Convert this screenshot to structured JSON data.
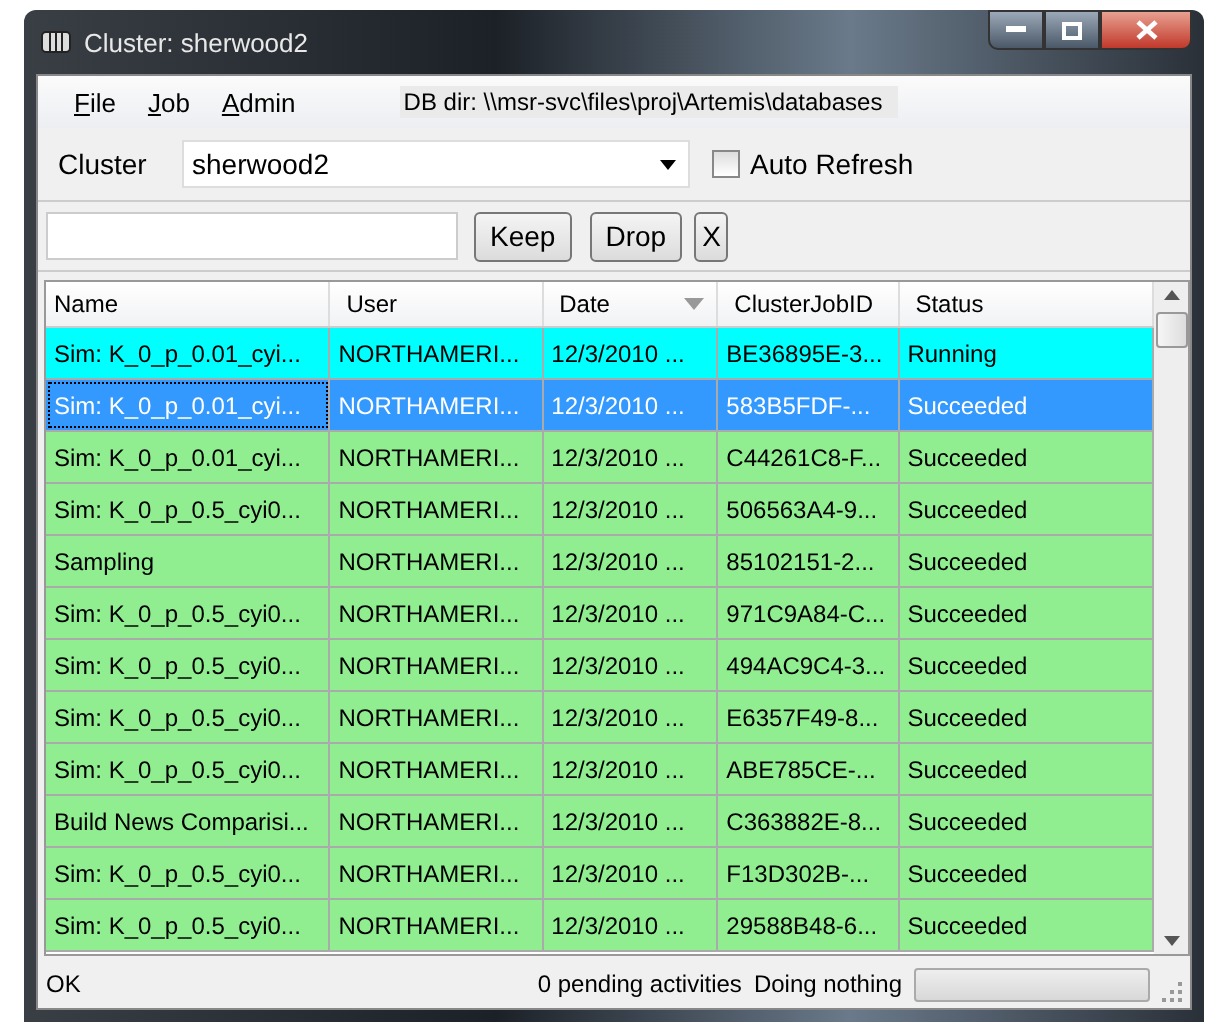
{
  "window": {
    "title": "Cluster: sherwood2"
  },
  "menu": [
    {
      "label": "File"
    },
    {
      "label": "Job"
    },
    {
      "label": "Admin"
    }
  ],
  "db_dir": "DB dir: \\\\msr-svc\\files\\proj\\Artemis\\databases",
  "cluster": {
    "label": "Cluster",
    "value": "sherwood2"
  },
  "auto_refresh": {
    "label": "Auto Refresh",
    "checked": false
  },
  "filter": {
    "buttons": [
      "Keep",
      "Drop",
      "X"
    ]
  },
  "table": {
    "columns": [
      {
        "label": "Name",
        "sorted": false
      },
      {
        "label": "User",
        "sorted": false
      },
      {
        "label": "Date",
        "sorted": true
      },
      {
        "label": "ClusterJobID",
        "sorted": false
      },
      {
        "label": "Status",
        "sorted": false
      }
    ],
    "rows": [
      {
        "cells": [
          "Sim: K_0_p_0.01_cyi...",
          "NORTHAMERI...",
          "12/3/2010 ...",
          "BE36895E-3...",
          "Running"
        ],
        "color": "#00ffff",
        "selected": false
      },
      {
        "cells": [
          "Sim: K_0_p_0.01_cyi...",
          "NORTHAMERI...",
          "12/3/2010 ...",
          "583B5FDF-...",
          "Succeeded"
        ],
        "selected": true
      },
      {
        "cells": [
          "Sim: K_0_p_0.01_cyi...",
          "NORTHAMERI...",
          "12/3/2010 ...",
          "C44261C8-F...",
          "Succeeded"
        ],
        "color": "#90ee90",
        "selected": false
      },
      {
        "cells": [
          "Sim: K_0_p_0.5_cyi0...",
          "NORTHAMERI...",
          "12/3/2010 ...",
          "506563A4-9...",
          "Succeeded"
        ],
        "color": "#90ee90",
        "selected": false
      },
      {
        "cells": [
          "Sampling",
          "NORTHAMERI...",
          "12/3/2010 ...",
          "85102151-2...",
          "Succeeded"
        ],
        "color": "#90ee90",
        "selected": false
      },
      {
        "cells": [
          "Sim: K_0_p_0.5_cyi0...",
          "NORTHAMERI...",
          "12/3/2010 ...",
          "971C9A84-C...",
          "Succeeded"
        ],
        "color": "#90ee90",
        "selected": false
      },
      {
        "cells": [
          "Sim: K_0_p_0.5_cyi0...",
          "NORTHAMERI...",
          "12/3/2010 ...",
          "494AC9C4-3...",
          "Succeeded"
        ],
        "color": "#90ee90",
        "selected": false
      },
      {
        "cells": [
          "Sim: K_0_p_0.5_cyi0...",
          "NORTHAMERI...",
          "12/3/2010 ...",
          "E6357F49-8...",
          "Succeeded"
        ],
        "color": "#90ee90",
        "selected": false
      },
      {
        "cells": [
          "Sim: K_0_p_0.5_cyi0...",
          "NORTHAMERI...",
          "12/3/2010 ...",
          "ABE785CE-...",
          "Succeeded"
        ],
        "color": "#90ee90",
        "selected": false
      },
      {
        "cells": [
          "Build News Comparisi...",
          "NORTHAMERI...",
          "12/3/2010 ...",
          "C363882E-8...",
          "Succeeded"
        ],
        "color": "#90ee90",
        "selected": false
      },
      {
        "cells": [
          "Sim: K_0_p_0.5_cyi0...",
          "NORTHAMERI...",
          "12/3/2010 ...",
          "F13D302B-...",
          "Succeeded"
        ],
        "color": "#90ee90",
        "selected": false
      },
      {
        "cells": [
          "Sim: K_0_p_0.5_cyi0...",
          "NORTHAMERI...",
          "12/3/2010 ...",
          "29588B48-6...",
          "Succeeded"
        ],
        "color": "#90ee90",
        "selected": false
      }
    ]
  },
  "status_bar": {
    "message": "OK",
    "pending": "0 pending activities",
    "activity": "Doing nothing",
    "level": 0
  }
}
